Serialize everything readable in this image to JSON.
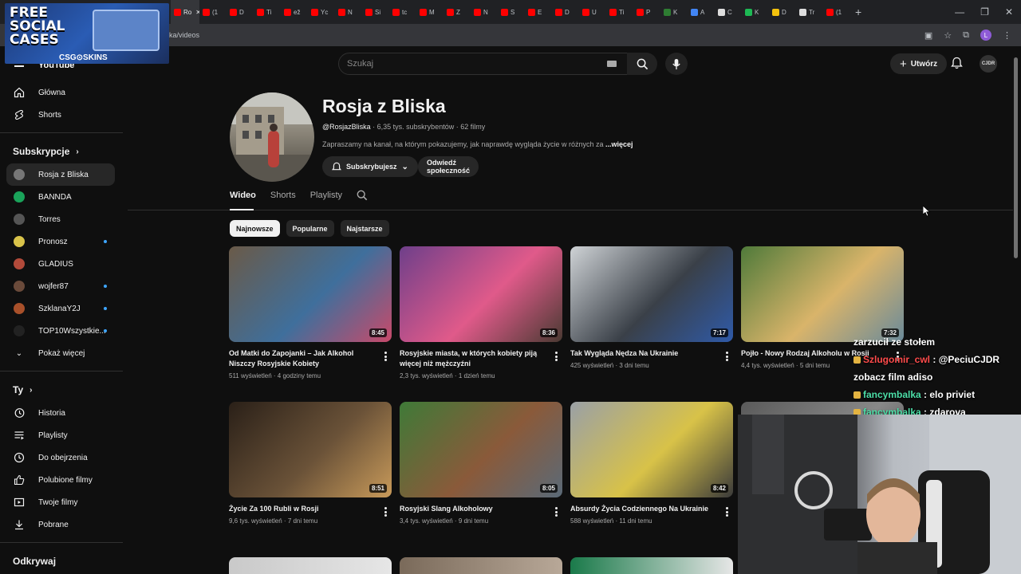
{
  "browser": {
    "tabs": [
      {
        "label": "Ro",
        "color": "#ff0000",
        "active": true
      },
      {
        "label": "(1",
        "color": "#ff0000"
      },
      {
        "label": "D",
        "color": "#ff0000"
      },
      {
        "label": "Ti",
        "color": "#ff0000"
      },
      {
        "label": "ež",
        "color": "#ff0000"
      },
      {
        "label": "Yc",
        "color": "#ff0000"
      },
      {
        "label": "N",
        "color": "#ff0000"
      },
      {
        "label": "Si",
        "color": "#ff0000"
      },
      {
        "label": "tc",
        "color": "#ff0000"
      },
      {
        "label": "M",
        "color": "#ff0000"
      },
      {
        "label": "Z",
        "color": "#ff0000"
      },
      {
        "label": "N",
        "color": "#ff0000"
      },
      {
        "label": "S",
        "color": "#ff0000"
      },
      {
        "label": "E",
        "color": "#ff0000"
      },
      {
        "label": "D",
        "color": "#ff0000"
      },
      {
        "label": "U",
        "color": "#ff0000"
      },
      {
        "label": "Ti",
        "color": "#ff0000"
      },
      {
        "label": "P",
        "color": "#ff0000"
      },
      {
        "label": "K",
        "color": "#2e7d32"
      },
      {
        "label": "A",
        "color": "#4285f4"
      },
      {
        "label": "C",
        "color": "#dddddd"
      },
      {
        "label": "K",
        "color": "#1db954"
      },
      {
        "label": "D",
        "color": "#f4c20d"
      },
      {
        "label": "Tr",
        "color": "#dddddd"
      },
      {
        "label": "(1",
        "color": "#ff0000"
      }
    ],
    "new_tab": "+",
    "url": "ka/videos",
    "profile_letter": "L"
  },
  "promo": {
    "title": "FREE SOCIAL CASES",
    "brand": "CSG⊙SKINS"
  },
  "header": {
    "logo": "YouTube",
    "search_placeholder": "Szukaj",
    "create_label": "Utwórz",
    "avatar_label": "CJDR"
  },
  "sidebar": {
    "main": [
      {
        "label": "Główna",
        "icon": "home-icon"
      },
      {
        "label": "Shorts",
        "icon": "shorts-icon"
      }
    ],
    "subs_heading": "Subskrypcje",
    "subs": [
      {
        "label": "Rosja z Bliska",
        "color": "#777",
        "selected": true
      },
      {
        "label": "BANNDA",
        "color": "#1aa35a"
      },
      {
        "label": "Torres",
        "color": "#555"
      },
      {
        "label": "Pronosz",
        "color": "#d9c34a",
        "dot": true
      },
      {
        "label": "GLADIUS",
        "color": "#b24a3a"
      },
      {
        "label": "wojfer87",
        "color": "#6a4a3a",
        "dot": true
      },
      {
        "label": "SzklanaY2J",
        "color": "#a8502a",
        "dot": true
      },
      {
        "label": "TOP10Wszystkie...",
        "color": "#222",
        "dot": true
      }
    ],
    "show_more": "Pokaż więcej",
    "you_heading": "Ty",
    "you": [
      {
        "label": "Historia",
        "icon": "history-icon"
      },
      {
        "label": "Playlisty",
        "icon": "playlist-icon"
      },
      {
        "label": "Do obejrzenia",
        "icon": "watch-later-icon"
      },
      {
        "label": "Polubione filmy",
        "icon": "like-icon"
      },
      {
        "label": "Twoje filmy",
        "icon": "your-videos-icon"
      },
      {
        "label": "Pobrane",
        "icon": "download-icon"
      }
    ],
    "explore_heading": "Odkrywaj"
  },
  "channel": {
    "name": "Rosja z Bliska",
    "handle": "@RosjazBliska",
    "subs": "6,35 tys. subskrybentów",
    "count": "62 filmy",
    "description": "Zapraszamy na kanał, na którym pokazujemy, jak naprawdę wygląda życie w różnych za",
    "more": "...więcej",
    "subscribed_label": "Subskrybujesz",
    "community_label": "Odwiedź społeczność",
    "tabs": [
      "Wideo",
      "Shorts",
      "Playlisty"
    ],
    "chips": [
      "Najnowsze",
      "Popularne",
      "Najstarsze"
    ]
  },
  "videos": [
    {
      "title": "Od Matki do Zapojanki – Jak Alkohol Niszczy Rosyjskie Kobiety",
      "views": "511 wyświetleń",
      "age": "4 godziny temu",
      "duration": "8:45",
      "colors": [
        "#6a5a48",
        "#3f6f9c",
        "#c84a6a"
      ]
    },
    {
      "title": "Rosyjskie miasta, w których kobiety piją więcej niż mężczyźni",
      "views": "2,3 tys. wyświetleń",
      "age": "1 dzień temu",
      "duration": "8:36",
      "colors": [
        "#6e3f8a",
        "#e05a8a",
        "#4a3a32"
      ]
    },
    {
      "title": "Tak Wygląda Nędza Na Ukrainie",
      "views": "425 wyświetleń",
      "age": "3 dni temu",
      "duration": "7:17",
      "colors": [
        "#cfd3d6",
        "#3a4048",
        "#2f5aa8"
      ]
    },
    {
      "title": "Pojło - Nowy Rodzaj Alkoholu w Rosji",
      "views": "4,4 tys. wyświetleń",
      "age": "5 dni temu",
      "duration": "7:32",
      "colors": [
        "#4f7a3a",
        "#d9b46a",
        "#6a8a9a"
      ]
    },
    {
      "title": "Życie Za 100 Rubli w Rosji",
      "views": "9,6 tys. wyświetleń",
      "age": "7 dni temu",
      "duration": "8:51",
      "colors": [
        "#2a2018",
        "#6a5238",
        "#c89a5a"
      ]
    },
    {
      "title": "Rosyjski Slang Alkoholowy",
      "views": "3,4 tys. wyświetleń",
      "age": "9 dni temu",
      "duration": "8:05",
      "colors": [
        "#3f7a38",
        "#8a5a3a",
        "#5a6a78"
      ]
    },
    {
      "title": "Absurdy Życia Codziennego Na Ukrainie",
      "views": "588 wyświetleń",
      "age": "11 dni temu",
      "duration": "8:42",
      "colors": [
        "#9aa0a6",
        "#d8c248",
        "#3a3a3a"
      ]
    },
    {
      "title": "",
      "views": "",
      "age": "",
      "duration": "",
      "colors": [
        "#5a5a5a",
        "#888",
        "#444"
      ]
    }
  ],
  "chat": [
    {
      "user": "",
      "text": "zarzucił ze stołem"
    },
    {
      "user": "Szlugomir_cwl",
      "text": ": @PeciuCJDR zobacz film adiso"
    },
    {
      "user": "fancymbalka",
      "text": ": elo priviet"
    },
    {
      "user": "fancymbalka",
      "text": ": zdarova"
    }
  ]
}
